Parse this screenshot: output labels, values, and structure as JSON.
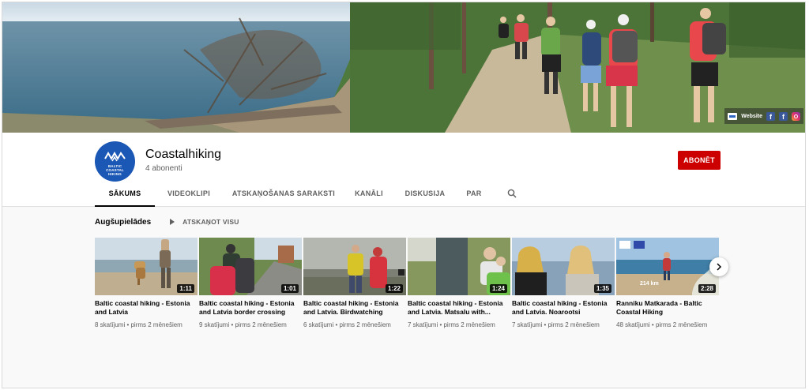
{
  "banner": {
    "website_label": "Website",
    "facebook_icon_glyph": "f",
    "icons": [
      "website-logo-icon",
      "facebook-icon",
      "facebook-icon",
      "instagram-icon"
    ]
  },
  "channel": {
    "name": "Coastalhiking",
    "subscribers": "4 abonenti",
    "subscribe_label": "ABONĒT",
    "avatar_text": [
      "BALTIC",
      "COASTAL",
      "HIKING"
    ],
    "brand_color": "#1b57b5",
    "subscribe_color": "#cc0000"
  },
  "tabs": [
    {
      "label": "SĀKUMS",
      "active": true
    },
    {
      "label": "VIDEOKLIPI",
      "active": false
    },
    {
      "label": "ATSKAŅOŠANAS SARAKSTI",
      "active": false
    },
    {
      "label": "KANĀLI",
      "active": false
    },
    {
      "label": "DISKUSIJA",
      "active": false
    },
    {
      "label": "PAR",
      "active": false
    }
  ],
  "section": {
    "title": "Augšupielādes",
    "play_all": "ATSKAŅOT VISU"
  },
  "videos": [
    {
      "title": "Baltic coastal hiking - Estonia and Latvia",
      "duration": "1:11",
      "views": "8 skatījumi",
      "age": "pirms 2 mēnešiem"
    },
    {
      "title": "Baltic coastal hiking - Estonia and Latvia border crossing",
      "duration": "1:01",
      "views": "9 skatījumi",
      "age": "pirms 2 mēnešiem"
    },
    {
      "title": "Baltic coastal hiking - Estonia and Latvia. Birdwatching",
      "duration": "1:22",
      "views": "6 skatījumi",
      "age": "pirms 2 mēnešiem"
    },
    {
      "title": "Baltic coastal hiking - Estonia and Latvia. Matsalu with...",
      "duration": "1:24",
      "views": "7 skatījumi",
      "age": "pirms 2 mēnešiem"
    },
    {
      "title": "Baltic coastal hiking - Estonia and Latvia. Noarootsi",
      "duration": "1:35",
      "views": "7 skatījumi",
      "age": "pirms 2 mēnešiem"
    },
    {
      "title": "Ranniku Matkarada - Baltic Coastal Hiking",
      "duration": "2:28",
      "views": "48 skatījumi",
      "age": "pirms 2 mēnešiem",
      "overlay_text": "214 km"
    }
  ]
}
